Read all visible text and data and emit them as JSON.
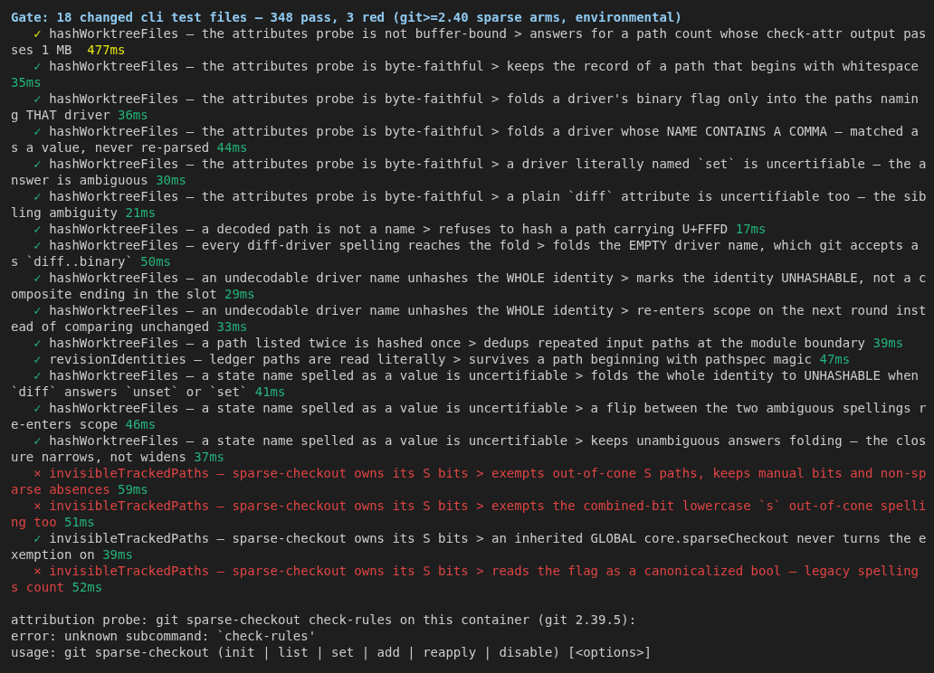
{
  "header": "Gate: 18 changed cli test files — 348 pass, 3 red (git>=2.40 sparse arms, environmental)",
  "tests": [
    {
      "kind": "slow",
      "mark": "✓",
      "text": "hashWorktreeFiles — the attributes probe is not buffer-bound > answers for a path count whose check-attr output passes 1 MB",
      "duration": "477ms"
    },
    {
      "kind": "pass",
      "mark": "✓",
      "text": "hashWorktreeFiles — the attributes probe is byte-faithful > keeps the record of a path that begins with whitespace",
      "duration": "35ms"
    },
    {
      "kind": "pass",
      "mark": "✓",
      "text": "hashWorktreeFiles — the attributes probe is byte-faithful > folds a driver's binary flag only into the paths naming THAT driver",
      "duration": "36ms"
    },
    {
      "kind": "pass",
      "mark": "✓",
      "text": "hashWorktreeFiles — the attributes probe is byte-faithful > folds a driver whose NAME CONTAINS A COMMA — matched as a value, never re-parsed",
      "duration": "44ms"
    },
    {
      "kind": "pass",
      "mark": "✓",
      "text": "hashWorktreeFiles — the attributes probe is byte-faithful > a driver literally named `set` is uncertifiable — the answer is ambiguous",
      "duration": "30ms"
    },
    {
      "kind": "pass",
      "mark": "✓",
      "text": "hashWorktreeFiles — the attributes probe is byte-faithful > a plain `diff` attribute is uncertifiable too — the sibling ambiguity",
      "duration": "21ms"
    },
    {
      "kind": "pass",
      "mark": "✓",
      "text": "hashWorktreeFiles — a decoded path is not a name > refuses to hash a path carrying U+FFFD",
      "duration": "17ms"
    },
    {
      "kind": "pass",
      "mark": "✓",
      "text": "hashWorktreeFiles — every diff-driver spelling reaches the fold > folds the EMPTY driver name, which git accepts as `diff..binary`",
      "duration": "50ms"
    },
    {
      "kind": "pass",
      "mark": "✓",
      "text": "hashWorktreeFiles — an undecodable driver name unhashes the WHOLE identity > marks the identity UNHASHABLE, not a composite ending in the slot",
      "duration": "29ms"
    },
    {
      "kind": "pass",
      "mark": "✓",
      "text": "hashWorktreeFiles — an undecodable driver name unhashes the WHOLE identity > re-enters scope on the next round instead of comparing unchanged",
      "duration": "33ms"
    },
    {
      "kind": "pass",
      "mark": "✓",
      "text": "hashWorktreeFiles — a path listed twice is hashed once > dedups repeated input paths at the module boundary",
      "duration": "39ms"
    },
    {
      "kind": "pass",
      "mark": "✓",
      "text": "revisionIdentities — ledger paths are read literally > survives a path beginning with pathspec magic",
      "duration": "47ms"
    },
    {
      "kind": "pass",
      "mark": "✓",
      "text": "hashWorktreeFiles — a state name spelled as a value is uncertifiable > folds the whole identity to UNHASHABLE when `diff` answers `unset` or `set`",
      "duration": "41ms"
    },
    {
      "kind": "pass",
      "mark": "✓",
      "text": "hashWorktreeFiles — a state name spelled as a value is uncertifiable > a flip between the two ambiguous spellings re-enters scope",
      "duration": "46ms"
    },
    {
      "kind": "pass",
      "mark": "✓",
      "text": "hashWorktreeFiles — a state name spelled as a value is uncertifiable > keeps unambiguous answers folding — the closure narrows, not widens",
      "duration": "37ms"
    },
    {
      "kind": "fail",
      "mark": "×",
      "text": "invisibleTrackedPaths — sparse-checkout owns its S bits > exempts out-of-cone S paths, keeps manual bits and non-sparse absences",
      "duration": "59ms"
    },
    {
      "kind": "fail",
      "mark": "×",
      "text": "invisibleTrackedPaths — sparse-checkout owns its S bits > exempts the combined-bit lowercase `s` out-of-cone spelling too",
      "duration": "51ms"
    },
    {
      "kind": "pass",
      "mark": "✓",
      "text": "invisibleTrackedPaths — sparse-checkout owns its S bits > an inherited GLOBAL core.sparseCheckout never turns the exemption on",
      "duration": "39ms"
    },
    {
      "kind": "fail",
      "mark": "×",
      "text": "invisibleTrackedPaths — sparse-checkout owns its S bits > reads the flag as a canonicalized bool — legacy spellings count",
      "duration": "52ms"
    }
  ],
  "footer": [
    "attribution probe: git sparse-checkout check-rules on this container (git 2.39.5):",
    "error: unknown subcommand: `check-rules'",
    "usage: git sparse-checkout (init | list | set | add | reapply | disable) [<options>]"
  ]
}
